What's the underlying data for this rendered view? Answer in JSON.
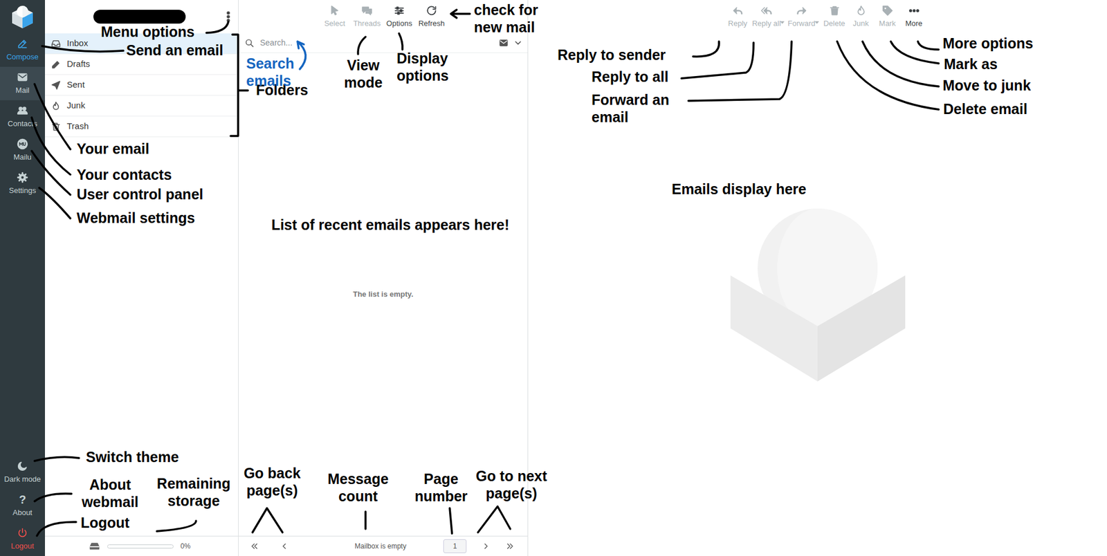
{
  "nav": [
    {
      "label": "Compose",
      "selected": false,
      "kind": "compose"
    },
    {
      "label": "Mail",
      "selected": true,
      "kind": "link"
    },
    {
      "label": "Contacts",
      "selected": false,
      "kind": "link"
    },
    {
      "label": "Mailu",
      "selected": false,
      "kind": "link"
    },
    {
      "label": "Settings",
      "selected": false,
      "kind": "link"
    }
  ],
  "nav_bottom": [
    {
      "label": "Dark mode",
      "kind": "link"
    },
    {
      "label": "About",
      "kind": "link",
      "glyph": "?"
    },
    {
      "label": "Logout",
      "kind": "danger"
    }
  ],
  "folders": [
    {
      "label": "Inbox",
      "selected": true
    },
    {
      "label": "Drafts",
      "selected": false
    },
    {
      "label": "Sent",
      "selected": false
    },
    {
      "label": "Junk",
      "selected": false
    },
    {
      "label": "Trash",
      "selected": false
    }
  ],
  "quota": {
    "level": 0,
    "reading": "0%"
  },
  "list_toolbar": [
    {
      "label": "Select",
      "disabled": true
    },
    {
      "label": "Threads",
      "disabled": true
    },
    {
      "label": "Options",
      "disabled": false
    },
    {
      "label": "Refresh",
      "disabled": false
    }
  ],
  "search": {
    "placeholder": "Search..."
  },
  "message_list": {
    "empty_text": "The list is empty."
  },
  "pager": {
    "count": "Mailbox is empty",
    "page": "1"
  },
  "message_toolbar": [
    {
      "label": "Reply",
      "disabled": true,
      "dropdown": false
    },
    {
      "label": "Reply all",
      "disabled": true,
      "dropdown": true
    },
    {
      "label": "Forward",
      "disabled": true,
      "dropdown": true
    },
    {
      "label": "Delete",
      "disabled": true,
      "dropdown": false
    },
    {
      "label": "Junk",
      "disabled": true,
      "dropdown": false
    },
    {
      "label": "Mark",
      "disabled": true,
      "dropdown": false
    },
    {
      "label": "More",
      "disabled": false,
      "dropdown": false
    }
  ],
  "annotations": [
    {
      "text": "Menu options",
      "color": "#000000"
    },
    {
      "text": "Send an email",
      "color": "#000000"
    },
    {
      "text": "Folders",
      "color": "#000000"
    },
    {
      "text": "Search emails",
      "color": "#1565c0"
    },
    {
      "text": "View mode",
      "color": "#000000"
    },
    {
      "text": "Display options",
      "color": "#000000"
    },
    {
      "text": "check for new mail",
      "color": "#000000"
    },
    {
      "text": "Reply to sender",
      "color": "#000000"
    },
    {
      "text": "Reply to all",
      "color": "#000000"
    },
    {
      "text": "Forward an email",
      "color": "#000000"
    },
    {
      "text": "More options",
      "color": "#000000"
    },
    {
      "text": "Mark as",
      "color": "#000000"
    },
    {
      "text": "Move to junk",
      "color": "#000000"
    },
    {
      "text": "Delete email",
      "color": "#000000"
    },
    {
      "text": "Your email",
      "color": "#000000"
    },
    {
      "text": "Your contacts",
      "color": "#000000"
    },
    {
      "text": "User control panel",
      "color": "#000000"
    },
    {
      "text": "Webmail settings",
      "color": "#000000"
    },
    {
      "text": "Emails display here",
      "color": "#000000"
    },
    {
      "text": "List of recent emails appears here!",
      "color": "#000000"
    },
    {
      "text": "Switch theme",
      "color": "#000000"
    },
    {
      "text": "About webmail",
      "color": "#000000"
    },
    {
      "text": "Remaining storage",
      "color": "#000000"
    },
    {
      "text": "Logout",
      "color": "#000000"
    },
    {
      "text": "Go back page(s)",
      "color": "#000000"
    },
    {
      "text": "Message count",
      "color": "#000000"
    },
    {
      "text": "Page number",
      "color": "#000000"
    },
    {
      "text": "Go to next page(s)",
      "color": "#000000"
    }
  ]
}
